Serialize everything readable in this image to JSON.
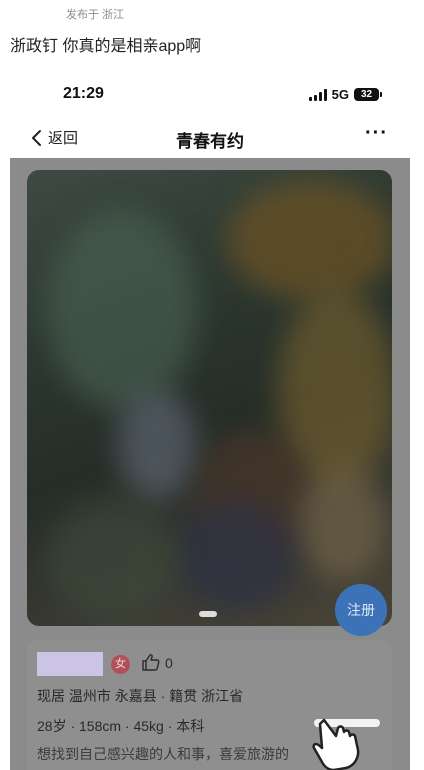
{
  "post": {
    "location": "发布于 浙江",
    "text": "浙政钉 你真的是相亲app啊"
  },
  "status_bar": {
    "time": "21:29",
    "network": "5G",
    "battery": "32"
  },
  "nav": {
    "back_label": "返回",
    "title": "青春有约",
    "more_label": "···"
  },
  "profile": {
    "register_label": "注册",
    "gender": "女",
    "likes": "0",
    "residence": "现居 温州市 永嘉县 · 籍贯 浙江省",
    "stats": "28岁 · 158cm · 45kg · 本科",
    "intro_partial": "想找到自己感兴趣的人和事，喜爱旅游的"
  },
  "colors": {
    "overlay": "#8b8b8b",
    "register_button": "#3c73b8",
    "gender_badge": "#b25059",
    "name_redaction": "#cbc4e4"
  }
}
